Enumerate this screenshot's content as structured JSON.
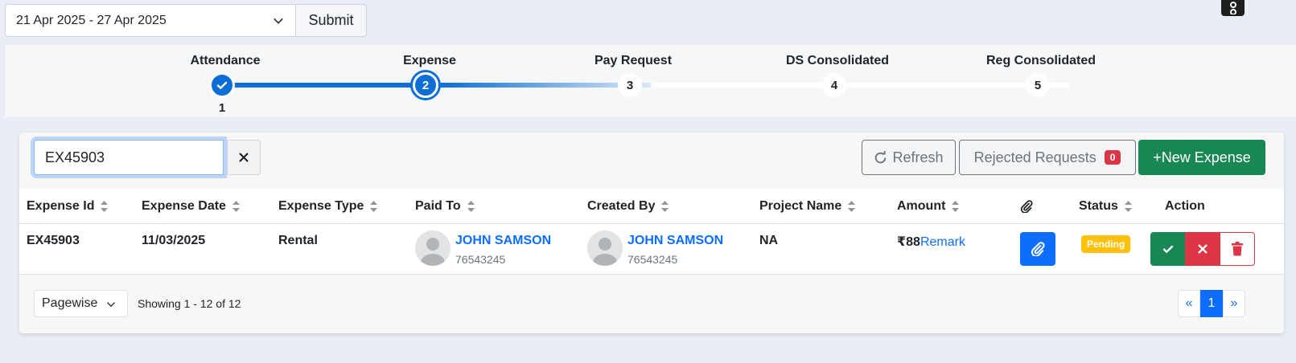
{
  "toolbar": {
    "date_range": "21 Apr 2025 - 27 Apr 2025",
    "submit_label": "Submit"
  },
  "stepper": {
    "steps": [
      {
        "label": "Attendance",
        "number": "1",
        "state": "done"
      },
      {
        "label": "Expense",
        "number": "2",
        "state": "current"
      },
      {
        "label": "Pay Request",
        "number": "3",
        "state": "pending"
      },
      {
        "label": "DS Consolidated",
        "number": "4",
        "state": "pending"
      },
      {
        "label": "Reg Consolidated",
        "number": "5",
        "state": "pending"
      }
    ]
  },
  "search": {
    "value": "EX45903"
  },
  "actions": {
    "refresh_label": "Refresh",
    "rejected_label": "Rejected Requests",
    "rejected_count": "0",
    "new_expense_label": "+New Expense"
  },
  "table": {
    "headers": {
      "expense_id": "Expense Id",
      "expense_date": "Expense Date",
      "expense_type": "Expense Type",
      "paid_to": "Paid To",
      "created_by": "Created By",
      "project_name": "Project Name",
      "amount": "Amount",
      "status": "Status",
      "action": "Action"
    },
    "rows": [
      {
        "expense_id": "EX45903",
        "expense_date": "11/03/2025",
        "expense_type": "Rental",
        "paid_to_name": "JOHN SAMSON",
        "paid_to_phone": "76543245",
        "created_by_name": "JOHN SAMSON",
        "created_by_phone": "76543245",
        "project_name": "NA",
        "amount": "₹88",
        "remark_label": "Remark",
        "status": "Pending"
      }
    ]
  },
  "footer": {
    "page_mode": "Pagewise",
    "showing": "Showing 1 - 12 of 12",
    "pager_prev": "«",
    "pager_current": "1",
    "pager_next": "»"
  },
  "colors": {
    "primary": "#0d6efd",
    "success": "#198754",
    "danger": "#dc3545",
    "warning": "#ffc107",
    "stepper_blue": "#0d6ed6"
  }
}
